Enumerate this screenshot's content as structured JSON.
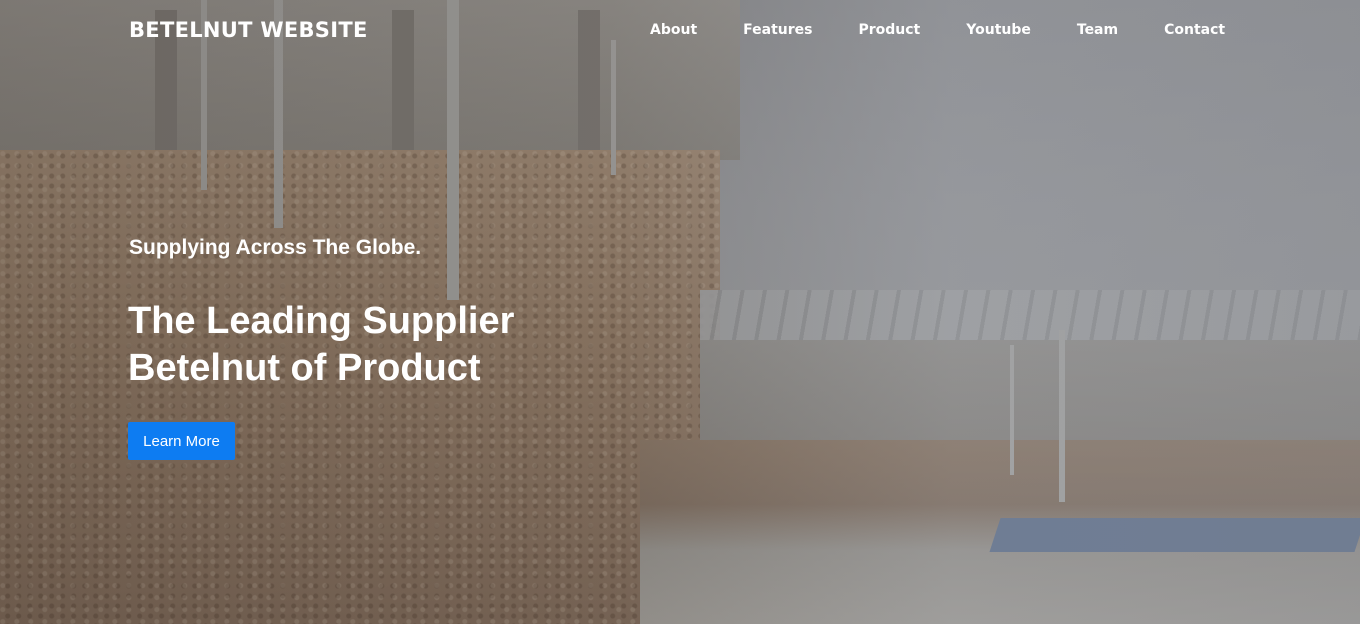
{
  "brand": {
    "name": "BETELNUT WEBSITE"
  },
  "nav": {
    "items": [
      {
        "label": "About"
      },
      {
        "label": "Features"
      },
      {
        "label": "Product"
      },
      {
        "label": "Youtube"
      },
      {
        "label": "Team"
      },
      {
        "label": "Contact"
      }
    ]
  },
  "hero": {
    "tagline": "Supplying Across The Globe.",
    "headline_line1": "The Leading Supplier",
    "headline_line2": "Betelnut of Product",
    "cta_label": "Learn More"
  },
  "colors": {
    "cta_background": "#0d7cf2",
    "text": "#ffffff"
  }
}
